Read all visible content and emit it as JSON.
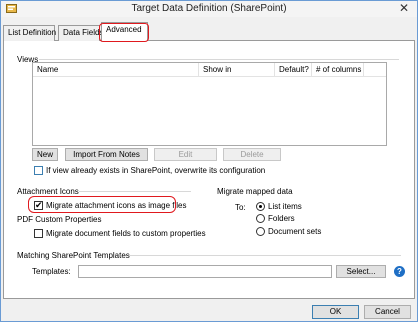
{
  "window": {
    "title": "Target Data Definition (SharePoint)"
  },
  "tabs": [
    {
      "label": "List Definition"
    },
    {
      "label": "Data Fields"
    },
    {
      "label": "Advanced",
      "active": true
    }
  ],
  "views": {
    "group_label": "Views",
    "columns": [
      "Name",
      "Show in",
      "Default?",
      "# of columns"
    ],
    "rows": [],
    "buttons": {
      "new": "New",
      "import": "Import From Notes",
      "edit": "Edit",
      "delete": "Delete"
    },
    "overwrite_checkbox": {
      "label": "If view already exists in SharePoint, overwrite its configuration",
      "checked": false
    }
  },
  "attachment_icons": {
    "group_label": "Attachment Icons",
    "migrate_checkbox": {
      "label": "Migrate attachment icons as image files",
      "checked": true
    }
  },
  "pdf_custom_properties": {
    "group_label": "PDF Custom Properties",
    "migrate_checkbox": {
      "label": "Migrate document fields to custom properties",
      "checked": false
    }
  },
  "migrate_mapped_data": {
    "group_label": "Migrate mapped data",
    "to_label": "To:",
    "options": [
      "List items",
      "Folders",
      "Document sets"
    ],
    "selected": "List items"
  },
  "matching_templates": {
    "group_label": "Matching SharePoint Templates",
    "templates_label": "Templates:",
    "templates_value": "",
    "select_button": "Select..."
  },
  "footer": {
    "ok": "OK",
    "cancel": "Cancel"
  },
  "colors": {
    "highlight": "#e0191e",
    "help": "#1f6fc5"
  }
}
